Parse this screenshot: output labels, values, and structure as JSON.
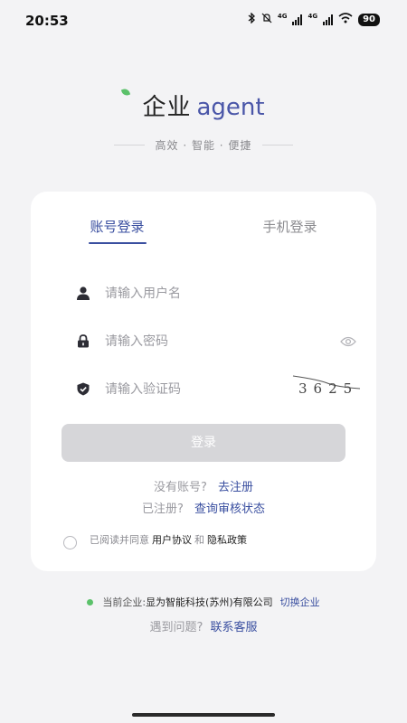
{
  "status_bar": {
    "time": "20:53",
    "net1": "4G",
    "net2": "4G",
    "battery": "90"
  },
  "brand": {
    "name_cn": "企业",
    "name_en": "agent",
    "slogan": "高效 · 智能 · 便捷"
  },
  "tabs": [
    {
      "label": "账号登录",
      "active": true
    },
    {
      "label": "手机登录",
      "active": false
    }
  ],
  "form": {
    "username_placeholder": "请输入用户名",
    "password_placeholder": "请输入密码",
    "captcha_placeholder": "请输入验证码",
    "captcha_code": "3625",
    "login_label": "登录"
  },
  "links": {
    "no_account": "没有账号?",
    "register": "去注册",
    "registered": "已注册?",
    "check_status": "查询审核状态"
  },
  "agreement": {
    "prefix": "已阅读并同意",
    "user_agreement": "用户协议",
    "and": "和",
    "privacy_policy": "隐私政策"
  },
  "company": {
    "label": "当前企业:",
    "name": "显为智能科技(苏州)有限公司",
    "switch": "切换企业"
  },
  "help": {
    "question": "遇到问题?",
    "contact": "联系客服"
  },
  "colors": {
    "accent": "#3a4fa0",
    "brand_green": "#5bc16a",
    "button_disabled": "#d6d6d9"
  }
}
